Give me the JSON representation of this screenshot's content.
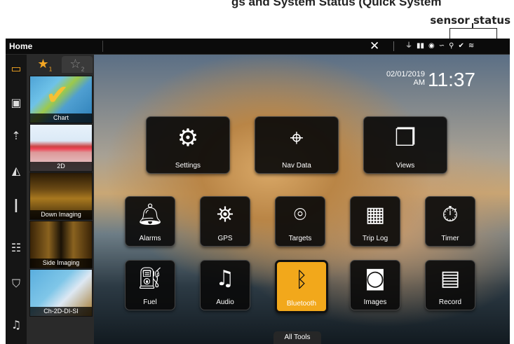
{
  "annotation": {
    "title_cut": "gs and System Status (Quick System",
    "sensor_status": "sensor status"
  },
  "topbar": {
    "title": "Home",
    "close_glyph": "✕",
    "status_icons": [
      "signal-icon",
      "antenna-icon",
      "gps-icon",
      "sonar-icon",
      "temp-icon",
      "check-icon",
      "wifi-icon"
    ]
  },
  "leftbar": {
    "items": [
      {
        "icon": "views-icon",
        "active": true
      },
      {
        "icon": "temp-gauge-icon"
      },
      {
        "icon": "trolling-motor-icon"
      },
      {
        "icon": "autopilot-icon"
      },
      {
        "icon": "transducer-icon"
      },
      {
        "icon": "equalizer-icon"
      },
      {
        "icon": "outboard-motor-icon"
      },
      {
        "icon": "music-icon"
      }
    ]
  },
  "favorites": {
    "tab1_label": "★",
    "tab1_sub": "1",
    "tab2_label": "☆",
    "tab2_sub": "2",
    "thumbs": [
      "Chart",
      "2D",
      "Down Imaging",
      "Side Imaging",
      "Ch-2D-DI-SI"
    ]
  },
  "clock": {
    "date": "02/01/2019",
    "ampm": "AM",
    "time": "11:37"
  },
  "tiles": {
    "settings": "Settings",
    "navdata": "Nav Data",
    "views": "Views",
    "alarms": "Alarms",
    "gps": "GPS",
    "targets": "Targets",
    "triplog": "Trip Log",
    "timer": "Timer",
    "fuel": "Fuel",
    "audio": "Audio",
    "bluetooth": "Bluetooth",
    "images": "Images",
    "record": "Record"
  },
  "bottom": {
    "all_tools": "All Tools"
  },
  "colors": {
    "accent": "#f2a81b",
    "tile_bg": "#0a0a0a"
  }
}
